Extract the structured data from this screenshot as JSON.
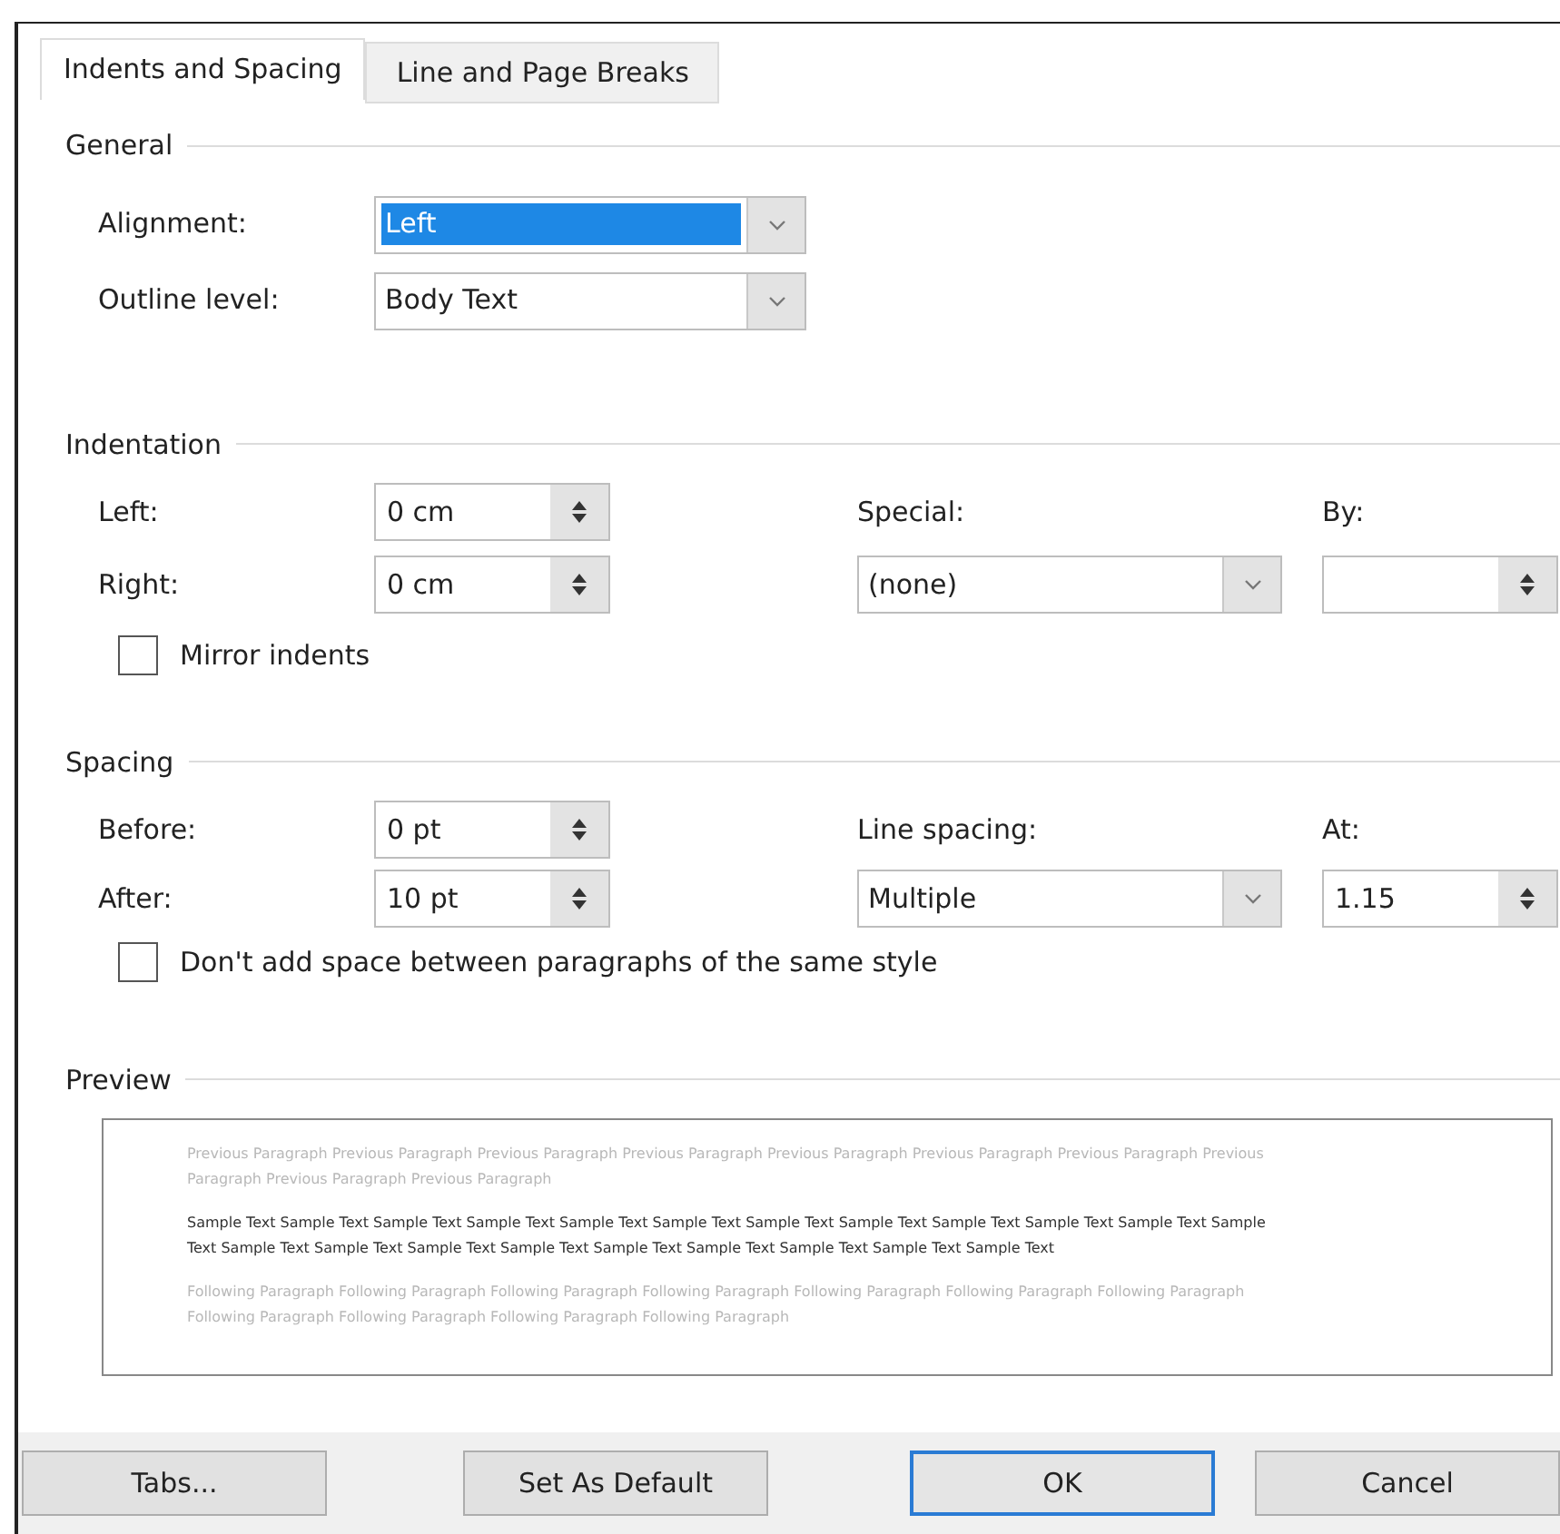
{
  "tabs": [
    {
      "label": "Indents and Spacing",
      "selected": true
    },
    {
      "label": "Line and Page Breaks",
      "selected": false
    }
  ],
  "general": {
    "title": "General",
    "alignment": {
      "label": "Alignment:",
      "value": "Left",
      "highlighted": true
    },
    "outline_level": {
      "label": "Outline level:",
      "value": "Body Text",
      "highlighted": false
    }
  },
  "indentation": {
    "title": "Indentation",
    "left": {
      "label": "Left:",
      "value": "0 cm"
    },
    "right": {
      "label": "Right:",
      "value": "0 cm"
    },
    "special": {
      "label": "Special:",
      "value": "(none)"
    },
    "by": {
      "label": "By:"
    },
    "mirror_indents": {
      "label": "Mirror indents",
      "checked": false
    }
  },
  "spacing": {
    "title": "Spacing",
    "before": {
      "label": "Before:",
      "value": "0 pt"
    },
    "after": {
      "label": "After:",
      "value": "10 pt"
    },
    "line_spacing": {
      "label": "Line spacing:",
      "value": "Multiple"
    },
    "at": {
      "label": "At:",
      "value": "1.15"
    },
    "dont_add_space": {
      "label": "Don't add space between paragraphs of the same style",
      "checked": false
    }
  },
  "preview": {
    "title": "Preview",
    "paragraphs": [
      {
        "kind": "previous",
        "text": "Previous Paragraph Previous Paragraph Previous Paragraph Previous Paragraph Previous Paragraph Previous Paragraph Previous Paragraph Previous Paragraph Previous Paragraph Previous Paragraph"
      },
      {
        "kind": "sample",
        "text": "Sample Text Sample Text Sample Text Sample Text Sample Text Sample Text Sample Text Sample Text Sample Text Sample Text Sample Text Sample Text Sample Text Sample Text Sample Text Sample Text Sample Text Sample Text Sample Text Sample Text Sample Text"
      },
      {
        "kind": "following",
        "text": "Following Paragraph Following Paragraph Following Paragraph Following Paragraph Following Paragraph Following Paragraph Following Paragraph Following Paragraph Following Paragraph Following Paragraph Following Paragraph"
      }
    ]
  },
  "buttons": [
    {
      "label": "Tabs...",
      "default": false
    },
    {
      "label": "Set As Default",
      "default": false
    },
    {
      "label": "OK",
      "default": true
    },
    {
      "label": "Cancel",
      "default": false
    }
  ]
}
